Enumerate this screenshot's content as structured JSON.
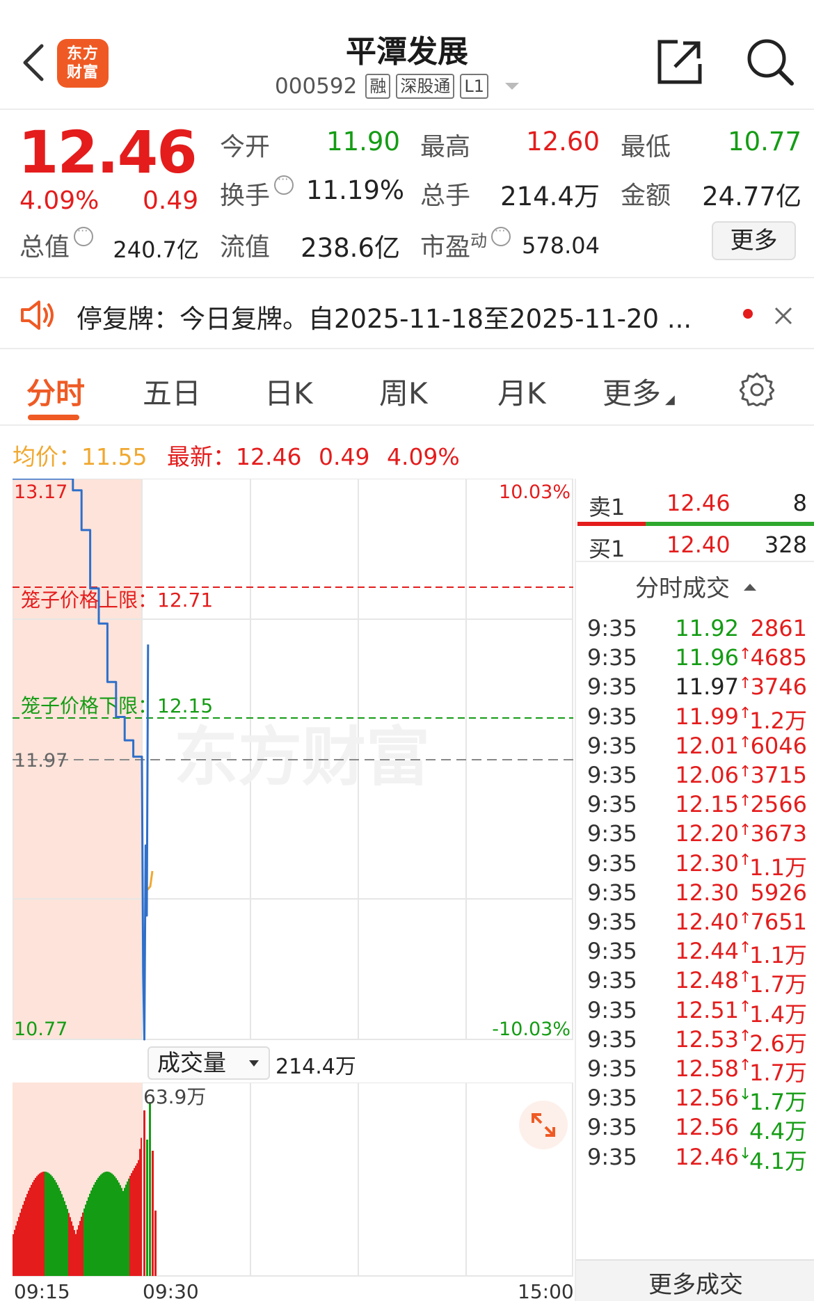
{
  "header": {
    "title": "平潭发展",
    "code": "000592",
    "tags": [
      "融",
      "深股通",
      "L1"
    ],
    "logo_line1": "东方",
    "logo_line2": "财富"
  },
  "quote": {
    "price": "12.46",
    "change_pct": "4.09%",
    "change": "0.49",
    "fields": {
      "open_label": "今开",
      "open": "11.90",
      "high_label": "最高",
      "high": "12.60",
      "low_label": "最低",
      "low": "10.77",
      "turnover_label": "换手",
      "turnover": "11.19%",
      "volume_label": "总手",
      "volume": "214.4万",
      "amount_label": "金额",
      "amount": "24.77亿",
      "mktcap_label": "总值",
      "mktcap": "240.7亿",
      "float_label": "流值",
      "float": "238.6亿",
      "pe_label": "市盈",
      "pe_sup": "动",
      "pe": "578.04"
    },
    "more_label": "更多"
  },
  "notice": {
    "text": "停复牌：今日复牌。自2025-11-18至2025-11-20 ..."
  },
  "tabs": [
    "分时",
    "五日",
    "日K",
    "周K",
    "月K",
    "更多"
  ],
  "avg_row": {
    "avg_label": "均价：",
    "avg_value": "11.55",
    "latest_label": "最新：",
    "latest_value": "12.46",
    "latest_change": "0.49",
    "latest_pct": "4.09%"
  },
  "chart": {
    "y_top": "13.17",
    "y_bottom": "10.77",
    "pct_top": "10.03%",
    "pct_bottom": "-10.03%",
    "prev_close": "11.97",
    "upper_cage_label": "笼子价格上限：",
    "upper_cage": "12.71",
    "lower_cage_label": "笼子价格下限：",
    "lower_cage": "12.15",
    "watermark": "东方财富",
    "volume_selector": "成交量",
    "volume_total": "214.4万",
    "volume_max": "63.9万",
    "time_labels": [
      "09:15",
      "09:30",
      "15:00"
    ]
  },
  "chart_data": {
    "type": "line",
    "ylim": [
      10.77,
      13.17
    ],
    "series": [
      {
        "x": [
          "09:15",
          "09:20",
          "09:22",
          "09:23",
          "09:24",
          "09:25",
          "09:26",
          "09:27",
          "09:28",
          "09:29",
          "09:30",
          "09:31",
          "09:32",
          "09:33",
          "09:34",
          "09:35"
        ],
        "values": [
          13.17,
          13.17,
          13.12,
          12.95,
          12.7,
          12.55,
          12.3,
          12.15,
          12.05,
          11.98,
          11.97,
          11.05,
          10.77,
          11.6,
          11.3,
          12.46
        ]
      }
    ]
  },
  "orderbook": {
    "sell_label": "卖1",
    "sell_price": "12.46",
    "sell_vol": "8",
    "buy_label": "买1",
    "buy_price": "12.40",
    "buy_vol": "328"
  },
  "trades": {
    "title": "分时成交",
    "footer": "更多成交",
    "rows": [
      {
        "t": "9:35",
        "p": "11.92",
        "c": "green",
        "a": "",
        "v": "2861",
        "vc": "red"
      },
      {
        "t": "9:35",
        "p": "11.96",
        "c": "green",
        "a": "↑",
        "v": "4685",
        "vc": "red"
      },
      {
        "t": "9:35",
        "p": "11.97",
        "c": "black",
        "a": "↑",
        "v": "3746",
        "vc": "red"
      },
      {
        "t": "9:35",
        "p": "11.99",
        "c": "red",
        "a": "↑",
        "v": "1.2万",
        "vc": "red"
      },
      {
        "t": "9:35",
        "p": "12.01",
        "c": "red",
        "a": "↑",
        "v": "6046",
        "vc": "red"
      },
      {
        "t": "9:35",
        "p": "12.06",
        "c": "red",
        "a": "↑",
        "v": "3715",
        "vc": "red"
      },
      {
        "t": "9:35",
        "p": "12.15",
        "c": "red",
        "a": "↑",
        "v": "2566",
        "vc": "red"
      },
      {
        "t": "9:35",
        "p": "12.20",
        "c": "red",
        "a": "↑",
        "v": "3673",
        "vc": "red"
      },
      {
        "t": "9:35",
        "p": "12.30",
        "c": "red",
        "a": "↑",
        "v": "1.1万",
        "vc": "red"
      },
      {
        "t": "9:35",
        "p": "12.30",
        "c": "red",
        "a": "",
        "v": "5926",
        "vc": "red"
      },
      {
        "t": "9:35",
        "p": "12.40",
        "c": "red",
        "a": "↑",
        "v": "7651",
        "vc": "red"
      },
      {
        "t": "9:35",
        "p": "12.44",
        "c": "red",
        "a": "↑",
        "v": "1.1万",
        "vc": "red"
      },
      {
        "t": "9:35",
        "p": "12.48",
        "c": "red",
        "a": "↑",
        "v": "1.7万",
        "vc": "red"
      },
      {
        "t": "9:35",
        "p": "12.51",
        "c": "red",
        "a": "↑",
        "v": "1.4万",
        "vc": "red"
      },
      {
        "t": "9:35",
        "p": "12.53",
        "c": "red",
        "a": "↑",
        "v": "2.6万",
        "vc": "red"
      },
      {
        "t": "9:35",
        "p": "12.58",
        "c": "red",
        "a": "↑",
        "v": "1.7万",
        "vc": "red"
      },
      {
        "t": "9:35",
        "p": "12.56",
        "c": "red",
        "a": "↓",
        "v": "1.7万",
        "vc": "green"
      },
      {
        "t": "9:35",
        "p": "12.56",
        "c": "red",
        "a": "",
        "v": "4.4万",
        "vc": "green"
      },
      {
        "t": "9:35",
        "p": "12.46",
        "c": "red",
        "a": "↓",
        "v": "4.1万",
        "vc": "green"
      }
    ]
  },
  "colors": {
    "up": "#e41c1c",
    "down": "#149c14",
    "brand": "#ef5a24",
    "price_line": "#2f6fc9",
    "avg_line": "#f0a830"
  }
}
